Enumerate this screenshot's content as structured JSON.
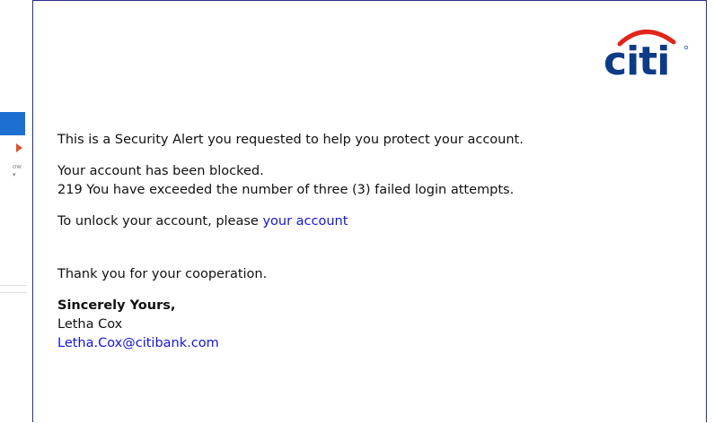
{
  "background_window": {
    "text_lines": [
      "ow",
      "▾"
    ]
  },
  "email": {
    "brand": "citi",
    "paragraphs": {
      "alert": "This is a Security Alert you requested to help you protect your account.",
      "blocked": "Your account has been blocked.",
      "attempts": "219 You have exceeded the number of three (3) failed login attempts.",
      "unlock_prefix": "To unlock your account, please ",
      "unlock_link": "your account",
      "thanks": "Thank you for your cooperation."
    },
    "signature": {
      "closing": "Sincerely Yours,",
      "name": "Letha Cox",
      "email_link": "Letha.Cox@citibank.com"
    }
  },
  "colors": {
    "border": "#2b2d8a",
    "link": "#1515d6",
    "logo_text": "#0d3c86",
    "logo_arc": "#e1251b"
  }
}
